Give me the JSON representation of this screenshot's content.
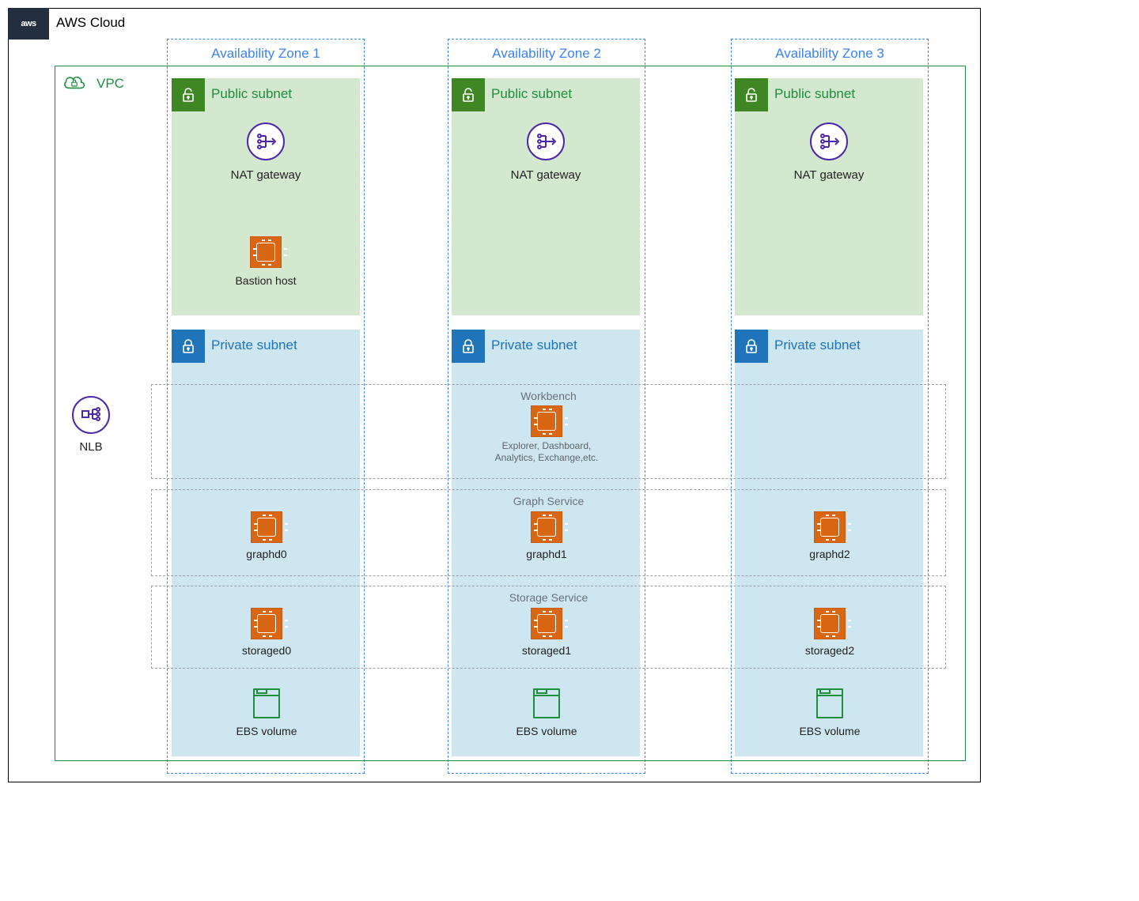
{
  "cloud": {
    "vendor_short": "aws",
    "title": "AWS Cloud"
  },
  "vpc": {
    "label": "VPC"
  },
  "az": {
    "z1": "Availability Zone 1",
    "z2": "Availability Zone 2",
    "z3": "Availability Zone 3"
  },
  "subnet": {
    "public": "Public subnet",
    "private": "Private subnet"
  },
  "nat": {
    "label": "NAT gateway"
  },
  "bastion": {
    "label": "Bastion host"
  },
  "nlb": {
    "label": "NLB"
  },
  "workbench": {
    "title": "Workbench",
    "desc": "Explorer, Dashboard, Analytics, Exchange,etc."
  },
  "graph_service": {
    "title": "Graph Service",
    "nodes": {
      "n0": "graphd0",
      "n1": "graphd1",
      "n2": "graphd2"
    }
  },
  "storage_service": {
    "title": "Storage Service",
    "nodes": {
      "n0": "storaged0",
      "n1": "storaged1",
      "n2": "storaged2"
    }
  },
  "ebs": {
    "label": "EBS volume"
  }
}
